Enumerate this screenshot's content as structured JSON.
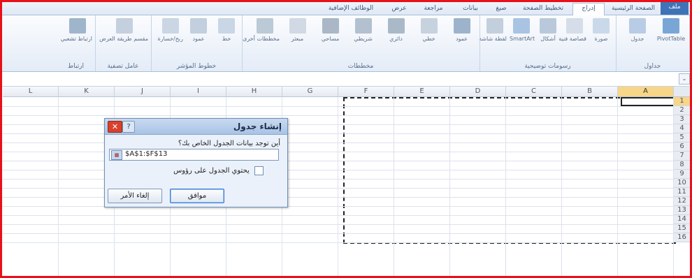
{
  "tabs": [
    {
      "label": "ملف",
      "active": false,
      "file": true
    },
    {
      "label": "الصفحة الرئيسية",
      "active": false
    },
    {
      "label": "إدراج",
      "active": true
    },
    {
      "label": "تخطيط الصفحة",
      "active": false
    },
    {
      "label": "صيغ",
      "active": false
    },
    {
      "label": "بيانات",
      "active": false
    },
    {
      "label": "مراجعة",
      "active": false
    },
    {
      "label": "عرض",
      "active": false
    },
    {
      "label": "الوظائف الإضافية",
      "active": false
    }
  ],
  "ribbon": {
    "groups": [
      {
        "name": "جداول",
        "buttons": [
          {
            "label": "PivotTable",
            "icon": "pivot-table-icon",
            "color": "#7aa6d6"
          },
          {
            "label": "جدول",
            "icon": "table-icon",
            "color": "#b8cce6"
          }
        ]
      },
      {
        "name": "رسومات توضيحية",
        "buttons": [
          {
            "label": "صورة",
            "icon": "picture-icon",
            "color": "#c9d9ea"
          },
          {
            "label": "قصاصة فنية",
            "icon": "clipart-icon",
            "color": "#d5dde8"
          },
          {
            "label": "أشكال",
            "icon": "shapes-icon",
            "color": "#b9c9db"
          },
          {
            "label": "SmartArt",
            "icon": "smartart-icon",
            "color": "#a9c4e2"
          },
          {
            "label": "لقطة شاشة",
            "icon": "screenshot-icon",
            "color": "#c3cfdc"
          }
        ]
      },
      {
        "name": "مخططات",
        "buttons": [
          {
            "label": "عمود",
            "icon": "column-chart-icon",
            "color": "#9db3cc"
          },
          {
            "label": "خطي",
            "icon": "line-chart-icon",
            "color": "#c7d2df"
          },
          {
            "label": "دائري",
            "icon": "pie-chart-icon",
            "color": "#aab9c8"
          },
          {
            "label": "شريطي",
            "icon": "bar-chart-icon",
            "color": "#b3c0cf"
          },
          {
            "label": "مساحي",
            "icon": "area-chart-icon",
            "color": "#a9b7c6"
          },
          {
            "label": "مبعثر",
            "icon": "scatter-chart-icon",
            "color": "#d0d9e4"
          },
          {
            "label": "مخططات أخرى",
            "icon": "other-charts-icon",
            "color": "#bcc9d7"
          }
        ]
      },
      {
        "name": "خطوط المؤشر",
        "buttons": [
          {
            "label": "خط",
            "icon": "sparkline-line-icon",
            "color": "#c9d6e5"
          },
          {
            "label": "عمود",
            "icon": "sparkline-column-icon",
            "color": "#c2cfde"
          },
          {
            "label": "ربح/خسارة",
            "icon": "win-loss-icon",
            "color": "#cad6e4"
          }
        ]
      },
      {
        "name": "عامل تصفية",
        "buttons": [
          {
            "label": "مقسم طريقة العرض",
            "icon": "slicer-icon",
            "color": "#c4d0de"
          }
        ]
      },
      {
        "name": "ارتباط",
        "buttons": [
          {
            "label": "ارتباط تشعبي",
            "icon": "hyperlink-icon",
            "color": "#9fb5cc"
          }
        ]
      }
    ]
  },
  "grid": {
    "columns": [
      "A",
      "B",
      "C",
      "D",
      "E",
      "F",
      "G",
      "H",
      "I",
      "J",
      "K",
      "L"
    ],
    "rows": [
      "1",
      "2",
      "3",
      "4",
      "5",
      "6",
      "7",
      "8",
      "9",
      "10",
      "11",
      "12",
      "13",
      "14",
      "15",
      "16"
    ],
    "selected_column": "A",
    "selected_row": "1"
  },
  "dialog": {
    "title": "إنشاء جدول",
    "question": "أين توجد بيانات الجدول الخاص بك؟",
    "range_value": "$A$1:$F$13",
    "checkbox_label": "يحتوي الجدول على رؤوس",
    "checkbox_checked": false,
    "ok_label": "موافق",
    "cancel_label": "إلغاء الأمر",
    "help_glyph": "?",
    "close_glyph": "✕"
  }
}
